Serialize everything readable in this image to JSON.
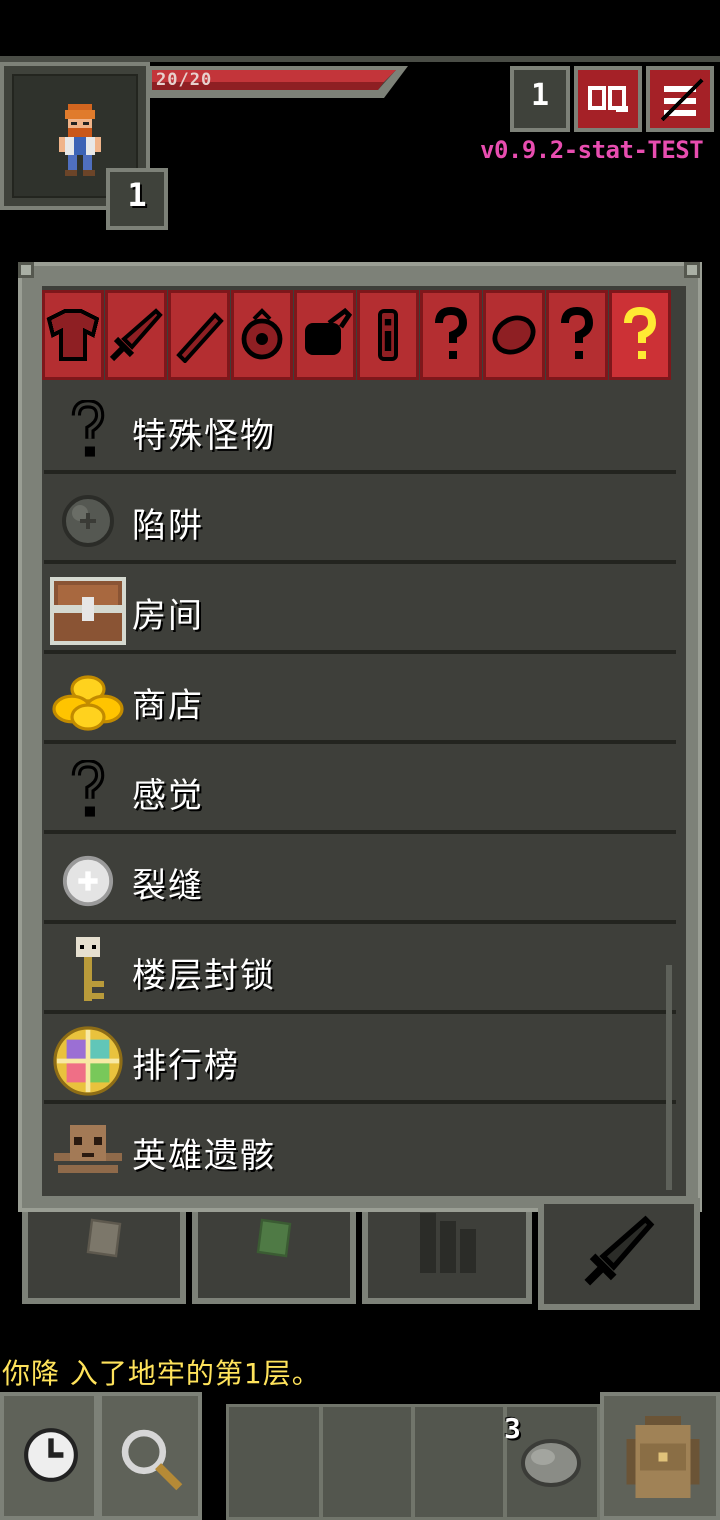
{
  "hud": {
    "hp_text": "20/20",
    "level": "1",
    "depth": "1",
    "version": "v0.9.2-stat-TEST"
  },
  "journal": {
    "tabs": [
      {
        "icon": "armor-icon"
      },
      {
        "icon": "sword-icon"
      },
      {
        "icon": "wand-icon"
      },
      {
        "icon": "ring-icon"
      },
      {
        "icon": "artifact-icon"
      },
      {
        "icon": "scroll-icon"
      },
      {
        "icon": "unknown-icon"
      },
      {
        "icon": "stone-icon"
      },
      {
        "icon": "unknown-icon"
      },
      {
        "icon": "unknown-selected-icon"
      }
    ],
    "items": [
      {
        "label": "特殊怪物",
        "icon": "question-mark-icon"
      },
      {
        "label": "陷阱",
        "icon": "trap-icon"
      },
      {
        "label": "房间",
        "icon": "chest-icon"
      },
      {
        "label": "商店",
        "icon": "gold-pile-icon"
      },
      {
        "label": "感觉",
        "icon": "question-mark-icon"
      },
      {
        "label": "裂缝",
        "icon": "rift-orb-icon"
      },
      {
        "label": "楼层封锁",
        "icon": "skull-key-icon"
      },
      {
        "label": "排行榜",
        "icon": "rankings-disc-icon"
      },
      {
        "label": "英雄遗骸",
        "icon": "skull-crossbones-icon"
      }
    ]
  },
  "bottom_tabs": [
    {
      "icon": "notes-icon"
    },
    {
      "icon": "catalog-icon"
    },
    {
      "icon": "badges-icon"
    },
    {
      "icon": "sword-icon"
    }
  ],
  "log": {
    "message": "你降 入了地牢的第1层。"
  },
  "toolbar": {
    "quickslot_qty": "3",
    "colors": {
      "accent": "#a52127",
      "log": "#ffe35b",
      "version": "#e84db0"
    }
  }
}
